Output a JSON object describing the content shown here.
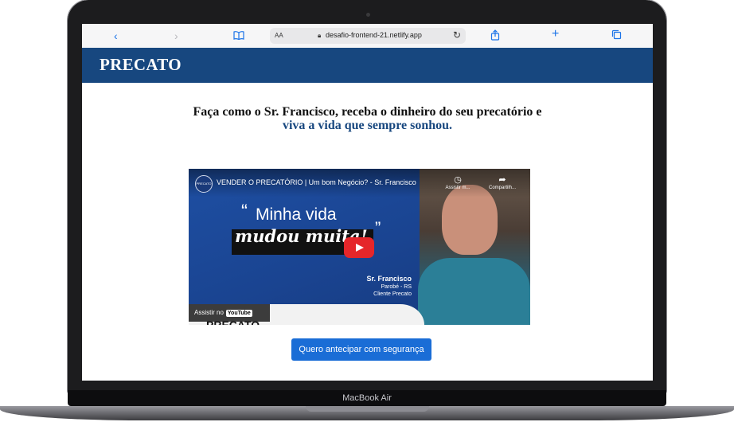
{
  "device": {
    "label": "MacBook Air"
  },
  "browser": {
    "text_size_label": "AA",
    "url": "desafio-frontend-21.netlify.app",
    "icons": [
      "back-icon",
      "forward-icon",
      "bookmarks-icon",
      "lock-icon",
      "reload-icon",
      "share-icon",
      "new-tab-icon",
      "tabs-icon"
    ]
  },
  "site": {
    "logo": "PRECATO",
    "headline_line1": "Faça como o Sr. Francisco, receba o dinheiro do seu precatório e",
    "headline_line2": "viva a vida que sempre sonhou.",
    "cta_label": "Quero antecipar com segurança"
  },
  "video": {
    "title": "VENDER O PRECATÓRIO | Um bom Negócio? - Sr. Francisco",
    "channel_badge": "PRECATO",
    "watch_later_label": "Assistir m...",
    "share_label": "Compartilh...",
    "quote_text": "Minha vida",
    "quote_emphasis": "mudou muita!",
    "speaker_name": "Sr. Francisco",
    "speaker_city": "Parobé - RS",
    "speaker_role": "Cliente Precato",
    "watch_on_label": "Assistir no",
    "youtube_label": "YouTube",
    "brand_fragment": "PRECATO"
  },
  "colors": {
    "brand_blue": "#17477f",
    "cta_blue": "#1a6dd6",
    "play_red": "#e5262a"
  }
}
